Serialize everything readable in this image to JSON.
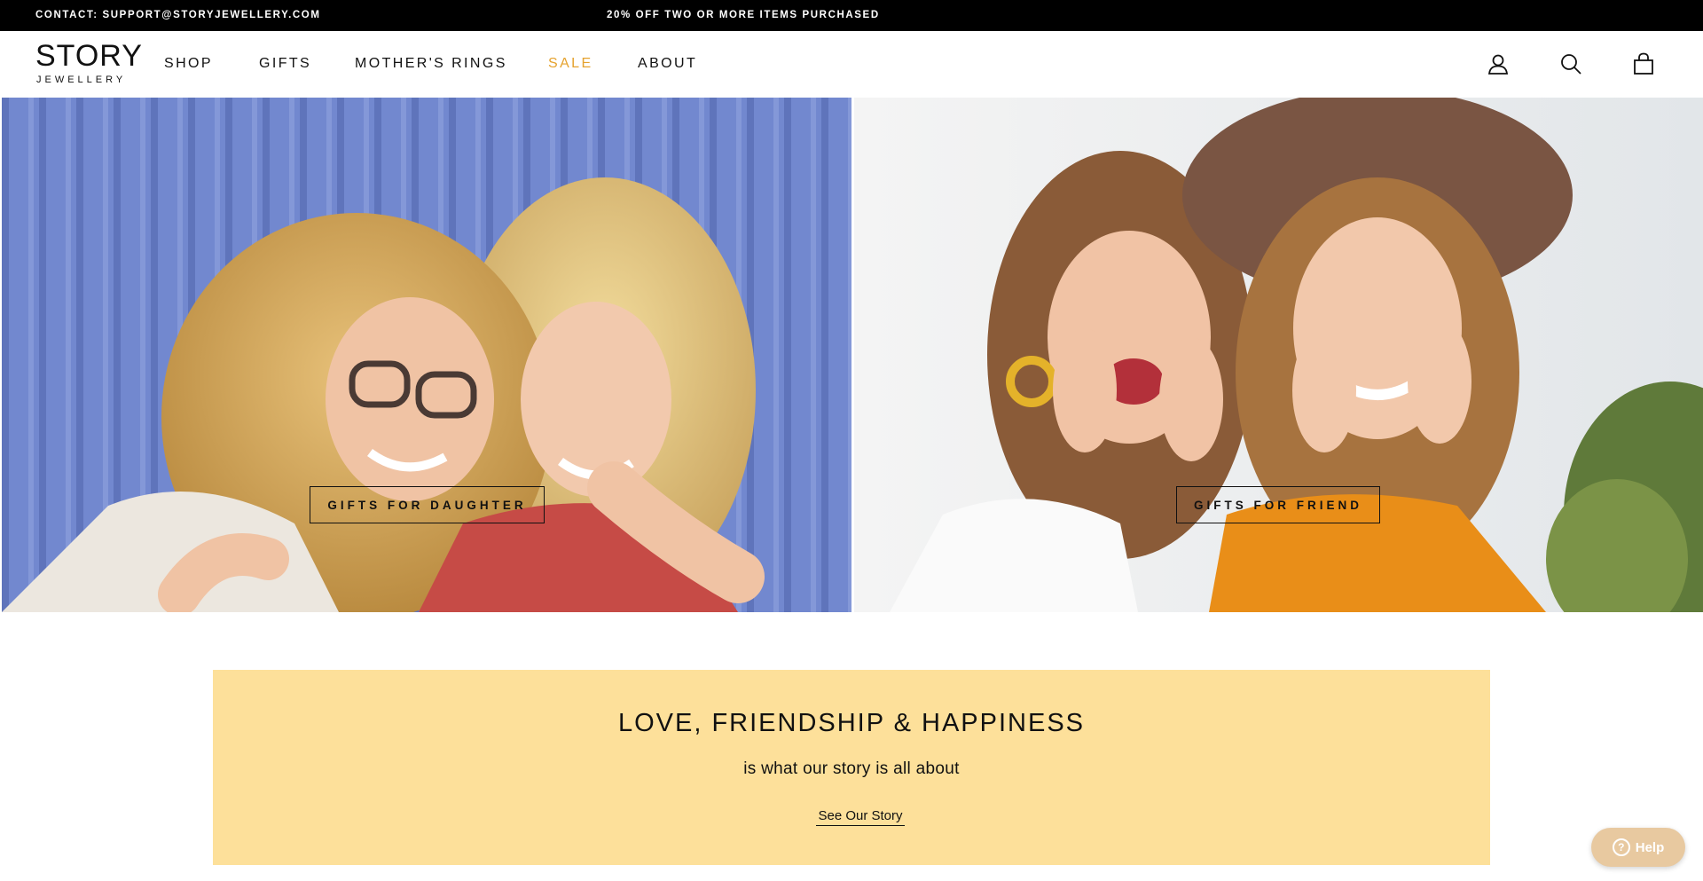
{
  "topbar": {
    "contact": "CONTACT: SUPPORT@STORYJEWELLERY.COM",
    "promo": "20% OFF TWO OR MORE ITEMS PURCHASED"
  },
  "header": {
    "logo_main": "STORY",
    "logo_sub": "JEWELLERY",
    "nav": {
      "shop": "SHOP",
      "gifts": "GIFTS",
      "mothers_rings": "MOTHER'S RINGS",
      "sale": "SALE",
      "about": "ABOUT"
    },
    "icons": [
      "account-icon",
      "search-icon",
      "cart-icon"
    ]
  },
  "hero": {
    "left_cta": "GIFTS FOR DAUGHTER",
    "right_cta": "GIFTS FOR FRIEND"
  },
  "story": {
    "heading": "LOVE, FRIENDSHIP & HAPPINESS",
    "subheading": "is what our story is all about",
    "link": "See Our Story"
  },
  "help": {
    "label": "Help"
  },
  "colors": {
    "sale": "#e5a22e",
    "story_bg": "#fde09a",
    "help_bg": "#e8c9a0"
  }
}
